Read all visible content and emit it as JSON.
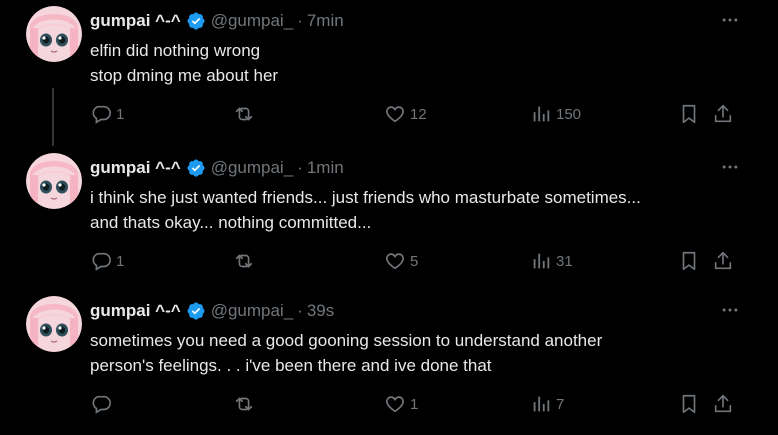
{
  "colors": {
    "background": "#000000",
    "text": "#e7e9ea",
    "muted": "#71767b",
    "verified": "#1d9bf0"
  },
  "tweets": [
    {
      "name": "gumpai ^-^",
      "handle": "@gumpai_",
      "dot": "·",
      "time": "7min",
      "lines": [
        "elfin did nothing wrong",
        "stop dming me about her"
      ],
      "replies": "1",
      "retweets": "",
      "likes": "12",
      "views": "150"
    },
    {
      "name": "gumpai ^-^",
      "handle": "@gumpai_",
      "dot": "·",
      "time": "1min",
      "lines": [
        "i think she just wanted friends... just friends who masturbate sometimes...",
        "and thats okay... nothing committed..."
      ],
      "replies": "1",
      "retweets": "",
      "likes": "5",
      "views": "31"
    },
    {
      "name": "gumpai ^-^",
      "handle": "@gumpai_",
      "dot": "·",
      "time": "39s",
      "lines": [
        "sometimes you need a good gooning session to understand another",
        "person's feelings. . . i've been there and ive done that"
      ],
      "replies": "",
      "retweets": "",
      "likes": "1",
      "views": "7"
    }
  ],
  "icons": {
    "more": "more-horizontal-icon",
    "reply": "reply-icon",
    "retweet": "retweet-icon",
    "like": "heart-icon",
    "views": "bar-chart-icon",
    "bookmark": "bookmark-icon",
    "share": "share-icon",
    "verified": "verified-badge-icon"
  }
}
